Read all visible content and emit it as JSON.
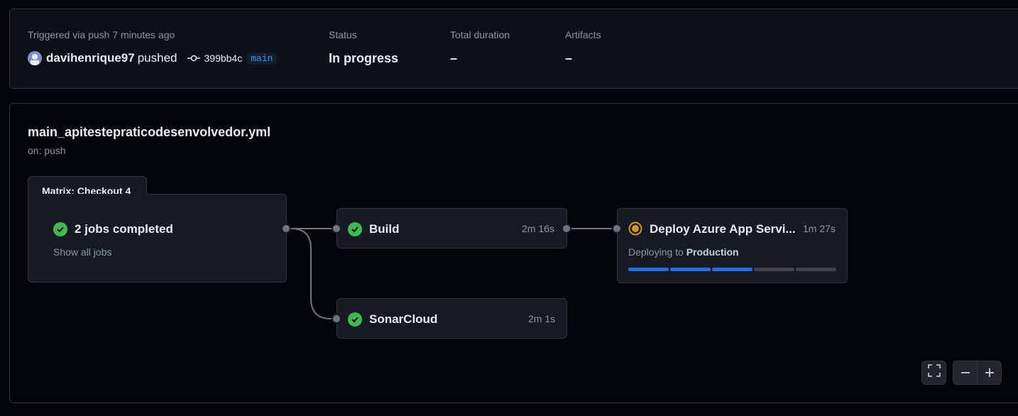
{
  "summary": {
    "trigger_text": "Triggered via push 7 minutes ago",
    "user": "davihenrique97",
    "action": "pushed",
    "commit": "399bb4c",
    "branch": "main",
    "status_label": "Status",
    "status_value": "In progress",
    "duration_label": "Total duration",
    "duration_value": "–",
    "artifacts_label": "Artifacts",
    "artifacts_value": "–"
  },
  "workflow": {
    "file": "main_apitestepraticodesenvolvedor.yml",
    "trigger": "on: push"
  },
  "matrix": {
    "title": "Matrix: Checkout 4",
    "status_text": "2 jobs completed",
    "link": "Show all jobs"
  },
  "jobs": [
    {
      "name": "Build",
      "time": "2m 16s",
      "status": "success"
    },
    {
      "name": "SonarCloud",
      "time": "2m 1s",
      "status": "success"
    },
    {
      "name": "Deploy Azure App Servi...",
      "time": "1m 27s",
      "status": "in_progress",
      "env_prefix": "Deploying to",
      "env_name": "Production",
      "progress_steps_total": 5,
      "progress_steps_done": 3
    }
  ],
  "colors": {
    "success": "#3fb950",
    "in_progress": "#d29922",
    "progress_fill": "#1f6feb",
    "progress_empty": "#3d444d"
  },
  "icons": {
    "commit": "git-commit-icon",
    "fullscreen": "fullscreen-icon",
    "zoom_out": "minus-icon",
    "zoom_in": "plus-icon"
  }
}
